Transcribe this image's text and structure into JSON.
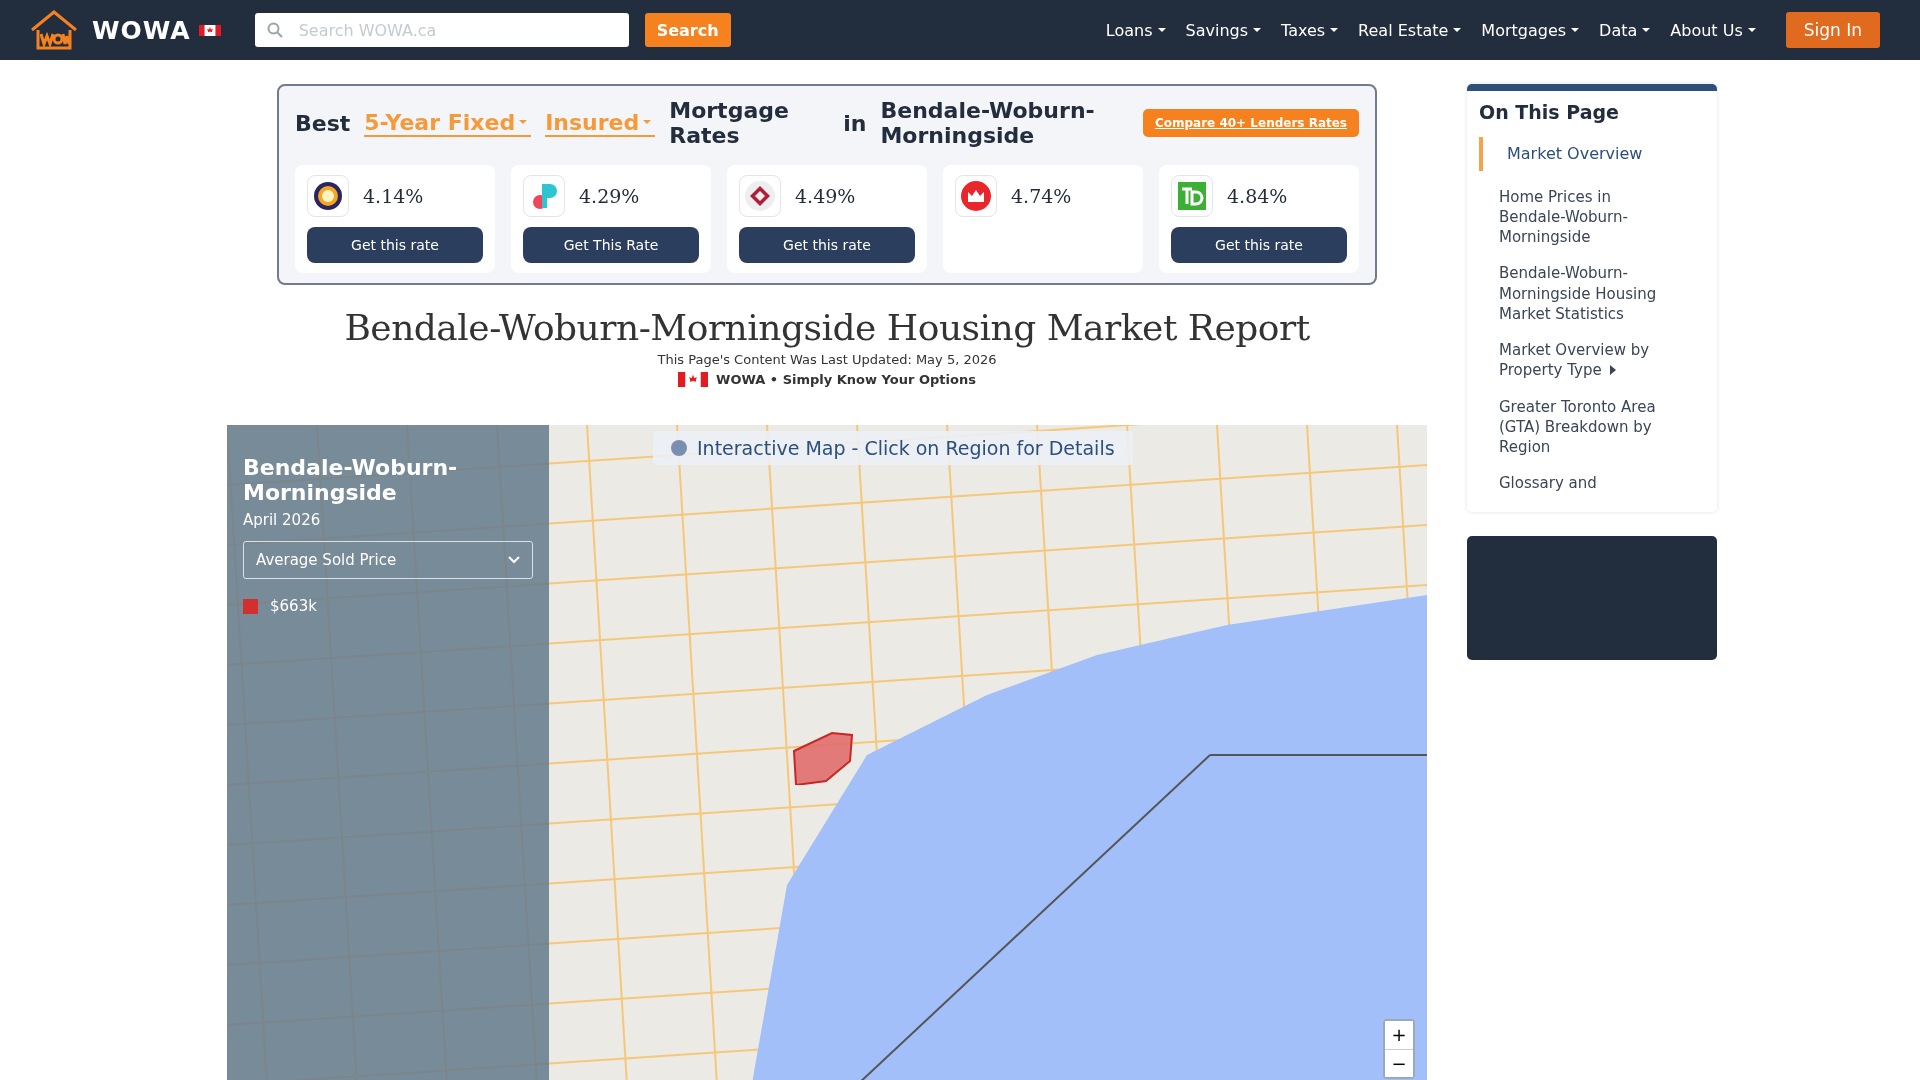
{
  "nav": {
    "brand": "WOWA",
    "search": {
      "placeholder": "Search WOWA.ca",
      "button": "Search"
    },
    "menu": [
      {
        "label": "Loans"
      },
      {
        "label": "Savings"
      },
      {
        "label": "Taxes"
      },
      {
        "label": "Real Estate"
      },
      {
        "label": "Mortgages"
      },
      {
        "label": "Data"
      },
      {
        "label": "About Us"
      }
    ],
    "sign_in": "Sign In"
  },
  "rates": {
    "best": "Best",
    "term": "5-Year Fixed",
    "insurance": "Insured",
    "mortgage": "Mortgage Rates",
    "in": "in",
    "region": "Bendale-Woburn-Morningside",
    "compare": "Compare 40+ Lenders Rates",
    "lenders": [
      {
        "kind": "ring",
        "rate": "4.14%",
        "button": "Get this rate"
      },
      {
        "kind": "p",
        "rate": "4.29%",
        "button": "Get This Rate"
      },
      {
        "kind": "diamond",
        "rate": "4.49%",
        "button": "Get this rate"
      },
      {
        "kind": "m",
        "rate": "4.74%"
      },
      {
        "kind": "td",
        "rate": "4.84%",
        "button": "Get this rate"
      }
    ]
  },
  "report": {
    "title": "Bendale-Woburn-Morningside Housing Market Report",
    "updated": "This Page's Content Was Last Updated: May 5, 2026",
    "tagline": "WOWA • Simply Know Your Options"
  },
  "map": {
    "banner": "Interactive Map - Click on Region for Details",
    "region": "Bendale-Woburn-Morningside",
    "period": "April 2026",
    "metric": "Average Sold Price",
    "legend": {
      "color": "#d32f2f",
      "value": "$663k"
    },
    "zoom_in": "+",
    "zoom_out": "−"
  },
  "sidebar": {
    "title": "On This Page",
    "items": [
      {
        "label": "Market Overview",
        "selected": true,
        "submenu": false
      },
      {
        "label": "Home Prices in Bendale-Woburn-Morningside",
        "selected": false,
        "submenu": false
      },
      {
        "label": "Bendale-Woburn-Morningside Housing Market Statistics",
        "selected": false,
        "submenu": false
      },
      {
        "label": "Market Overview by Property Type",
        "selected": false,
        "submenu": true
      },
      {
        "label": "Greater Toronto Area (GTA) Breakdown by Region",
        "selected": false,
        "submenu": false
      },
      {
        "label": "Glossary and",
        "selected": false,
        "submenu": false
      }
    ]
  }
}
